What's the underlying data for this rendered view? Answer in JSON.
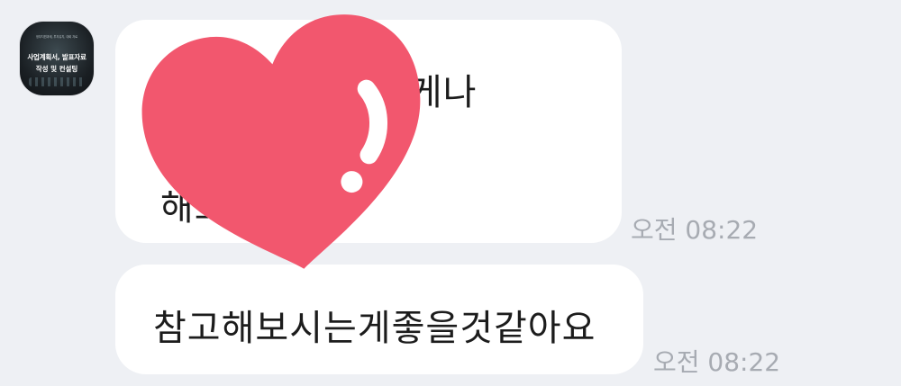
{
  "sender": {
    "avatar_caption_small": "정부지원과제, 투자유치, 대회 자료",
    "avatar_caption_line1": "사업계획서, 발표자료",
    "avatar_caption_line2": "작성 및 컨설팅"
  },
  "messages": [
    {
      "line1_visible": "오늘 저 게나",
      "line2_visible": "해드릴게요!",
      "time": "오전 08:22"
    },
    {
      "text": "참고해보시는게좋을것같아요",
      "time": "오전 08:22"
    }
  ],
  "reaction": {
    "icon": "heart-reaction",
    "color": "#f2576e"
  }
}
